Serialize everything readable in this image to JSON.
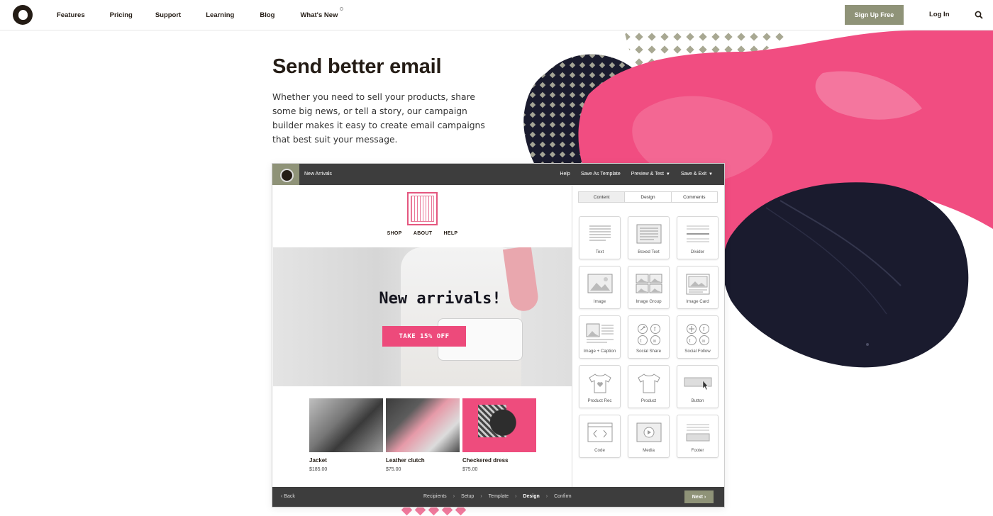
{
  "nav": {
    "logo": "mailchimp-logo",
    "links": [
      "Features",
      "Pricing",
      "Support",
      "Learning",
      "Blog",
      "What's New"
    ],
    "signup": "Sign Up Free",
    "login": "Log In"
  },
  "hero": {
    "title": "Send better email",
    "body": "Whether you need to sell your products, share some big news, or tell a story, our campaign builder makes it easy to create email campaigns that best suit your message."
  },
  "builder": {
    "campaign_name": "New Arrivals",
    "actions": {
      "help": "Help",
      "save_template": "Save As Template",
      "preview_test": "Preview & Test",
      "save_exit": "Save & Exit"
    },
    "email": {
      "nav": [
        "SHOP",
        "ABOUT",
        "HELP"
      ],
      "headline": "New arrivals!",
      "cta": "TAKE 15% OFF",
      "products": [
        {
          "name": "Jacket",
          "price": "$185.00"
        },
        {
          "name": "Leather clutch",
          "price": "$75.00"
        },
        {
          "name": "Checkered dress",
          "price": "$75.00"
        }
      ]
    },
    "tabs": [
      "Content",
      "Design",
      "Comments"
    ],
    "active_tab": "Content",
    "blocks": [
      "Text",
      "Boxed Text",
      "Divider",
      "Image",
      "Image Group",
      "Image Card",
      "Image + Caption",
      "Social Share",
      "Social Follow",
      "Product Rec",
      "Product",
      "Button",
      "Code",
      "Media",
      "Footer"
    ],
    "footer": {
      "back": "Back",
      "steps": [
        "Recipients",
        "Setup",
        "Template",
        "Design",
        "Confirm"
      ],
      "active_step": "Design",
      "next": "Next"
    }
  },
  "colors": {
    "brand_olive": "#8f9378",
    "pink": "#ed4a7b",
    "navy": "#1a1b2e",
    "dark_bar": "#3d3d3d"
  }
}
